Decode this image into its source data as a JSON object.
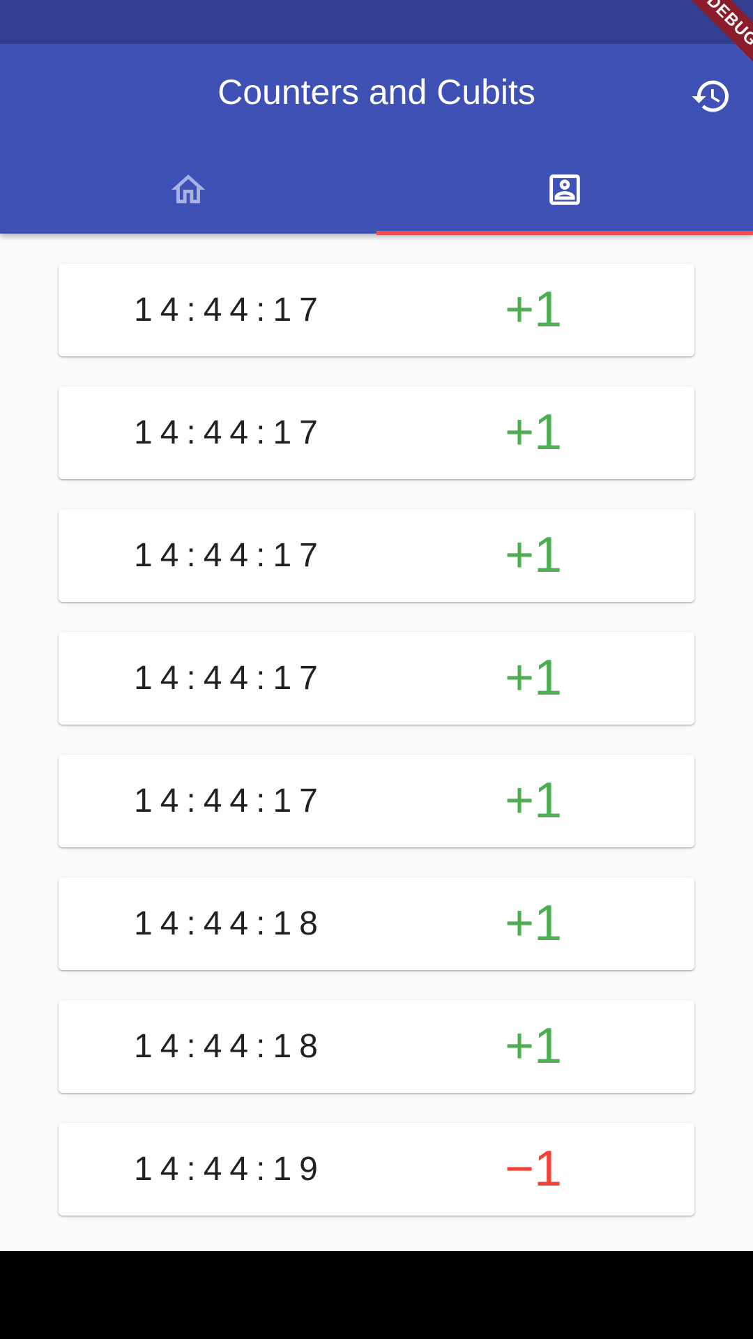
{
  "app": {
    "title": "Counters and Cubits",
    "debug_label": "DEBUG"
  },
  "header": {
    "actions": [
      {
        "icon": "history-icon"
      }
    ]
  },
  "tabs": [
    {
      "icon": "home-icon",
      "selected": false
    },
    {
      "icon": "account-box-icon",
      "selected": true
    }
  ],
  "colors": {
    "status_bar": "#32408f",
    "app_bar": "#3f51b5",
    "indicator": "#ef5350",
    "positive": "#4caf50",
    "negative": "#f44336",
    "background": "#fafafa"
  },
  "entries": [
    {
      "time": "14:44:17",
      "delta": "+1",
      "kind": "positive"
    },
    {
      "time": "14:44:17",
      "delta": "+1",
      "kind": "positive"
    },
    {
      "time": "14:44:17",
      "delta": "+1",
      "kind": "positive"
    },
    {
      "time": "14:44:17",
      "delta": "+1",
      "kind": "positive"
    },
    {
      "time": "14:44:17",
      "delta": "+1",
      "kind": "positive"
    },
    {
      "time": "14:44:18",
      "delta": "+1",
      "kind": "positive"
    },
    {
      "time": "14:44:18",
      "delta": "+1",
      "kind": "positive"
    },
    {
      "time": "14:44:19",
      "delta": "−1",
      "kind": "negative"
    }
  ]
}
